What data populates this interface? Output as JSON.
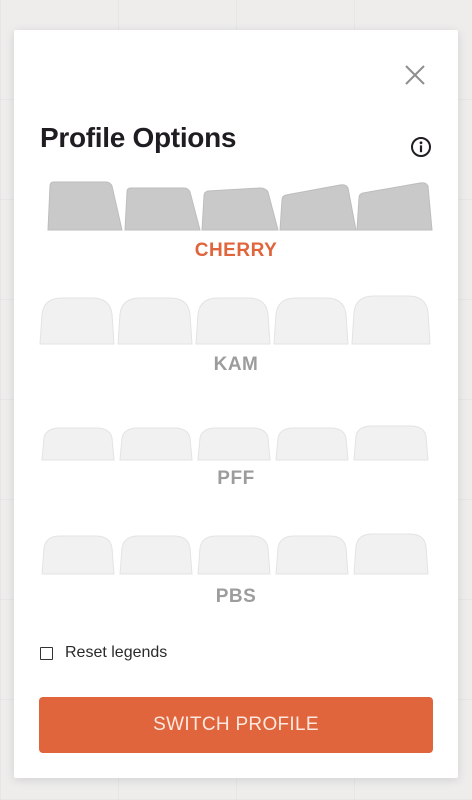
{
  "dialog": {
    "title": "Profile Options"
  },
  "icons": {
    "close": "close-icon",
    "info": "info-icon"
  },
  "profiles": [
    {
      "name": "CHERRY",
      "selected": true
    },
    {
      "name": "KAM",
      "selected": false
    },
    {
      "name": "PFF",
      "selected": false
    },
    {
      "name": "PBS",
      "selected": false
    }
  ],
  "reset_legends": {
    "label": "Reset legends",
    "checked": false
  },
  "switch_button": {
    "label": "SWITCH PROFILE"
  },
  "colors": {
    "accent": "#e0643c",
    "selected_keycap": "#c9c9c9",
    "unselected_keycap": "#f1f1f1",
    "unselected_label": "#9c9c9c"
  }
}
